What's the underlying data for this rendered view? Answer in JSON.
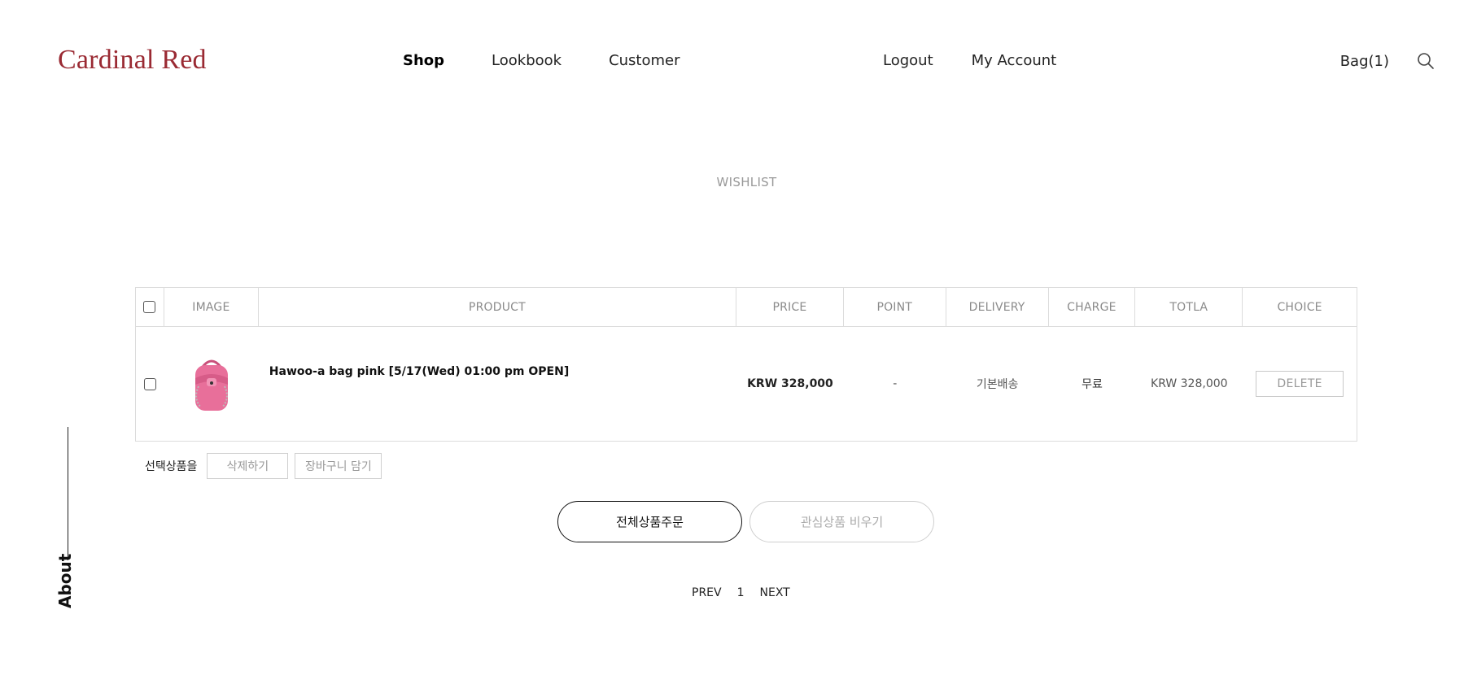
{
  "brand": {
    "logo_text": "Cardinal Red",
    "color": "#9a2a33"
  },
  "nav": {
    "main": [
      {
        "label": "Shop",
        "active": true
      },
      {
        "label": "Lookbook",
        "active": false
      },
      {
        "label": "Customer",
        "active": false
      }
    ],
    "account": [
      {
        "label": "Logout"
      },
      {
        "label": "My Account"
      }
    ],
    "bag_label": "Bag(1)",
    "search_icon": "search-icon"
  },
  "page": {
    "title": "WISHLIST"
  },
  "table": {
    "headers": {
      "image": "IMAGE",
      "product": "PRODUCT",
      "price": "PRICE",
      "point": "POINT",
      "delivery": "DELIVERY",
      "charge": "CHARGE",
      "total": "TOTLA",
      "choice": "CHOICE"
    },
    "rows": [
      {
        "product": "Hawoo-a bag pink [5/17(Wed) 01:00 pm OPEN]",
        "price": "KRW 328,000",
        "point": "-",
        "delivery": "기본배송",
        "charge": "무료",
        "total": "KRW 328,000",
        "delete_label": "DELETE",
        "thumb_color": "#e86f9a"
      }
    ]
  },
  "selection": {
    "label": "선택상품을",
    "delete_label": "삭제하기",
    "cart_label": "장바구니 담기"
  },
  "actions": {
    "order_all": "전체상품주문",
    "clear_wishlist": "관심상품 비우기"
  },
  "pagination": {
    "prev": "PREV",
    "page": "1",
    "next": "NEXT"
  },
  "side": {
    "about": "About"
  }
}
